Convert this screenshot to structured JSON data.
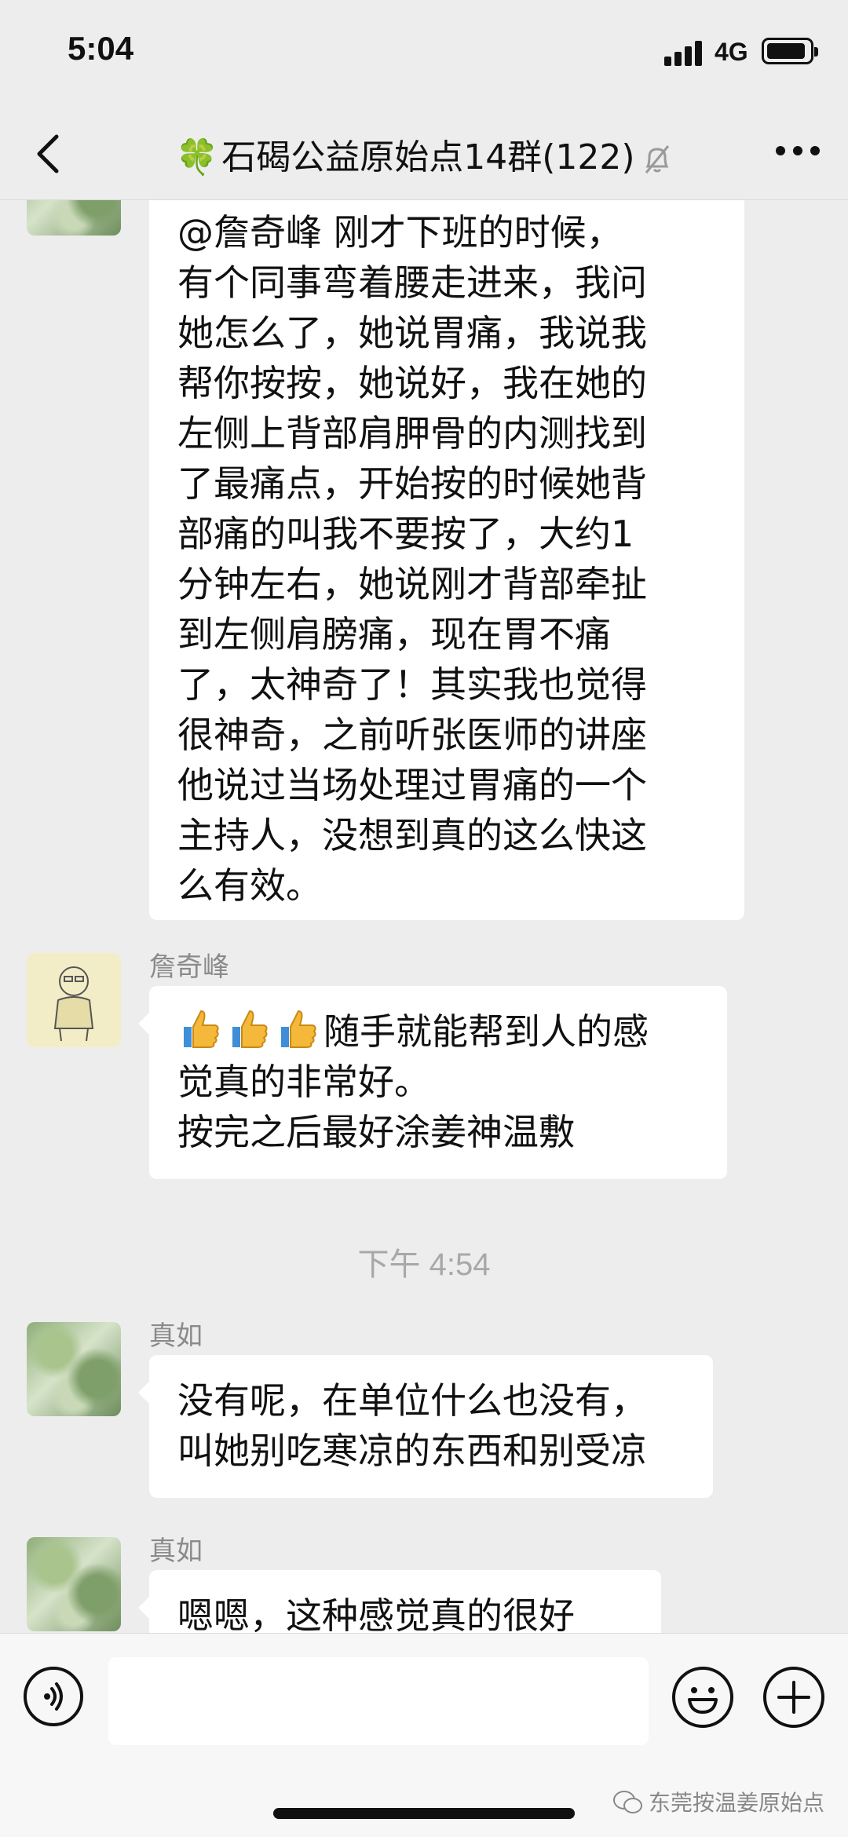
{
  "status": {
    "time": "5:04",
    "network": "4G"
  },
  "nav": {
    "clover": "🍀",
    "title": "石碣公益原始点14群(122)"
  },
  "messages": [
    {
      "text": "@詹奇峰 刚才下班的时候，\n有个同事弯着腰走进来，我问\n她怎么了，她说胃痛，我说我\n帮你按按，她说好，我在她的\n左侧上背部肩胛骨的内测找到\n了最痛点，开始按的时候她背\n部痛的叫我不要按了，大约1\n分钟左右，她说刚才背部牵扯\n到左侧肩膀痛，现在胃不痛\n了，太神奇了！其实我也觉得\n很神奇，之前听张医师的讲座\n他说过当场处理过胃痛的一个\n主持人，没想到真的这么快这\n么有效。"
    },
    {
      "sender": "詹奇峰",
      "text_line1": "随手就能帮到人的感",
      "text_rest": "觉真的非常好。\n按完之后最好涂姜神温敷"
    },
    {
      "sender": "真如",
      "text": "没有呢，在单位什么也没有，\n叫她别吃寒凉的东西和别受凉"
    },
    {
      "sender": "真如",
      "text": "嗯嗯，这种感觉真的很好"
    }
  ],
  "time_separator": "下午 4:54",
  "watermark": "东莞按温姜原始点",
  "icons": [
    "back-icon",
    "mute-bell-icon",
    "more-icon",
    "voice-icon",
    "emoji-icon",
    "plus-icon",
    "thumbs-up-icon",
    "wechat-icon"
  ]
}
